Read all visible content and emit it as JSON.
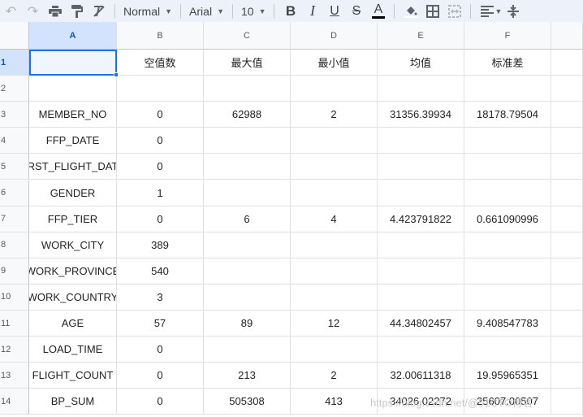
{
  "toolbar": {
    "style_select": "Normal",
    "font_select": "Arial",
    "size_select": "10",
    "icons": [
      "undo-icon",
      "redo-icon",
      "print-icon",
      "paint-format-icon",
      "clear-format-icon",
      "bold-icon",
      "italic-icon",
      "underline-icon",
      "strikethrough-icon",
      "text-color-icon",
      "fill-color-icon",
      "borders-icon",
      "merge-cells-icon",
      "align-icon",
      "vertical-align-icon"
    ],
    "bold": "B",
    "italic": "I",
    "underline": "U",
    "strike": "S",
    "textcolor": "A",
    "text_color_hex": "#000000"
  },
  "columns": [
    "A",
    "B",
    "C",
    "D",
    "E",
    "F"
  ],
  "selected_cell": "A1",
  "rows": [
    {
      "num": "1",
      "cells": [
        "",
        "空值数",
        "最大值",
        "最小值",
        "均值",
        "标准差"
      ]
    },
    {
      "num": "2",
      "cells": [
        "",
        "",
        "",
        "",
        "",
        ""
      ]
    },
    {
      "num": "3",
      "cells": [
        "MEMBER_NO",
        "0",
        "62988",
        "2",
        "31356.39934",
        "18178.79504"
      ]
    },
    {
      "num": "4",
      "cells": [
        "FFP_DATE",
        "0",
        "",
        "",
        "",
        ""
      ]
    },
    {
      "num": "5",
      "cells": [
        "RST_FLIGHT_DAT",
        "0",
        "",
        "",
        "",
        ""
      ]
    },
    {
      "num": "6",
      "cells": [
        "GENDER",
        "1",
        "",
        "",
        "",
        ""
      ]
    },
    {
      "num": "7",
      "cells": [
        "FFP_TIER",
        "0",
        "6",
        "4",
        "4.423791822",
        "0.661090996"
      ]
    },
    {
      "num": "8",
      "cells": [
        "WORK_CITY",
        "389",
        "",
        "",
        "",
        ""
      ]
    },
    {
      "num": "9",
      "cells": [
        "WORK_PROVINCE",
        "540",
        "",
        "",
        "",
        ""
      ]
    },
    {
      "num": "10",
      "cells": [
        "WORK_COUNTRY",
        "3",
        "",
        "",
        "",
        ""
      ]
    },
    {
      "num": "11",
      "cells": [
        "AGE",
        "57",
        "89",
        "12",
        "44.34802457",
        "9.408547783"
      ]
    },
    {
      "num": "12",
      "cells": [
        "LOAD_TIME",
        "0",
        "",
        "",
        "",
        ""
      ]
    },
    {
      "num": "13",
      "cells": [
        "FLIGHT_COUNT",
        "0",
        "213",
        "2",
        "32.00611318",
        "19.95965351"
      ]
    },
    {
      "num": "14",
      "cells": [
        "BP_SUM",
        "0",
        "505308",
        "413",
        "34026.02272",
        "25607.00507"
      ]
    }
  ],
  "watermark": "https://blog.csdn.net/@51CTO博客"
}
